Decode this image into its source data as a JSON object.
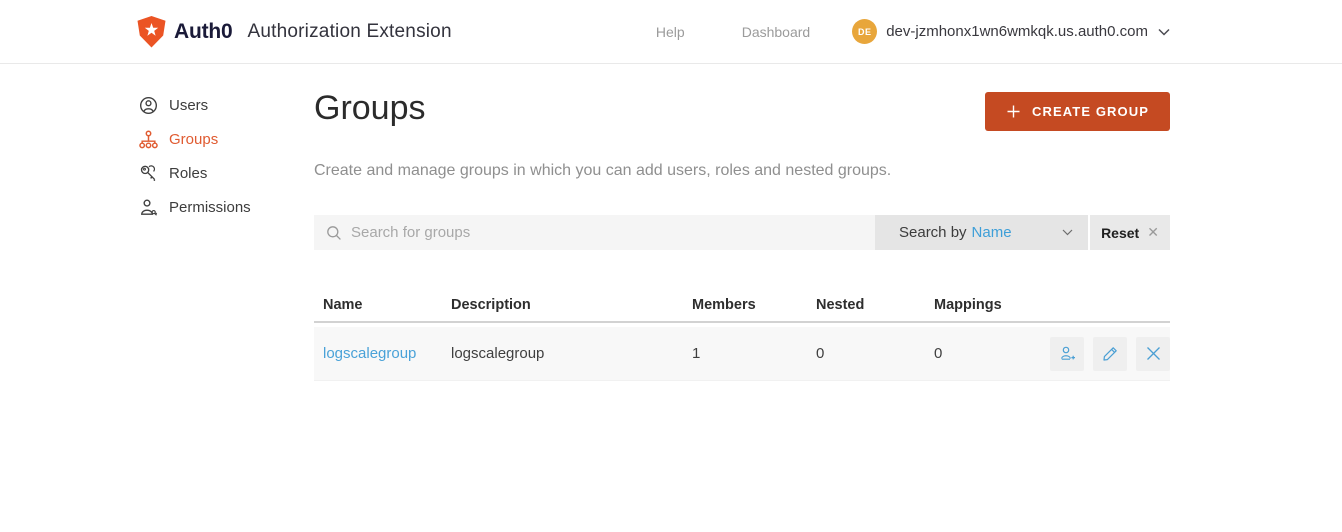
{
  "header": {
    "brand": "Auth0",
    "app_title": "Authorization Extension",
    "nav": [
      {
        "label": "Help"
      },
      {
        "label": "Dashboard"
      }
    ],
    "avatar_initials": "DE",
    "tenant": "dev-jzmhonx1wn6wmkqk.us.auth0.com"
  },
  "sidebar": {
    "items": [
      {
        "label": "Users",
        "active": false
      },
      {
        "label": "Groups",
        "active": true
      },
      {
        "label": "Roles",
        "active": false
      },
      {
        "label": "Permissions",
        "active": false
      }
    ]
  },
  "main": {
    "title": "Groups",
    "create_button_label": "CREATE GROUP",
    "description": "Create and manage groups in which you can add users, roles and nested groups.",
    "search": {
      "placeholder": "Search for groups",
      "search_by_label": "Search by",
      "search_by_value": "Name",
      "reset_label": "Reset"
    },
    "table": {
      "columns": [
        "Name",
        "Description",
        "Members",
        "Nested",
        "Mappings"
      ],
      "rows": [
        {
          "name": "logscalegroup",
          "description": "logscalegroup",
          "members": "1",
          "nested": "0",
          "mappings": "0"
        }
      ]
    }
  },
  "colors": {
    "brand_orange": "#eb5424",
    "button_orange": "#c54a22",
    "active_nav_orange": "#e05b31",
    "link_blue": "#4aa2d8",
    "avatar_amber": "#e8a63b"
  }
}
